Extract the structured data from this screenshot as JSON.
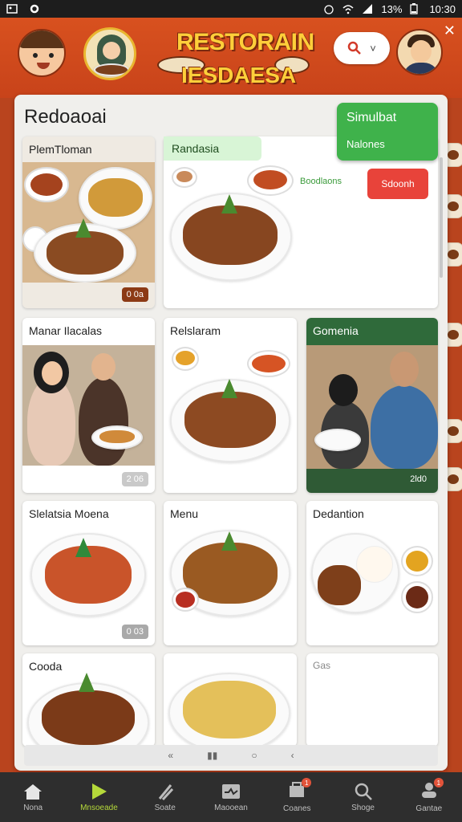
{
  "status_bar": {
    "battery": "13%",
    "time": "10:30"
  },
  "header": {
    "logo_line1": "RESTORAIN",
    "logo_line2": "IESDAESA",
    "search_chevron": "˅",
    "close": "✕"
  },
  "panel": {
    "title": "Redoaoai"
  },
  "popup": {
    "line1": "Simulbat",
    "line2": "Nalones"
  },
  "cards": {
    "c1": {
      "title": "PlemTloman",
      "badge": "0 0a"
    },
    "c2": {
      "tag": "Randasia",
      "link": "Boodlaons",
      "button": "Sdoonh"
    },
    "c3": {
      "title": "Manar Ilacalas",
      "badge": "2 06"
    },
    "c4": {
      "title": "Relslaram"
    },
    "c5": {
      "title": "Gomenia",
      "badge": "2ld0"
    },
    "c6": {
      "title": "Slelatsia Moena",
      "badge": "0 03"
    },
    "c7": {
      "title": "Menu"
    },
    "c8": {
      "title": "Dedantion"
    },
    "c9": {
      "title": "Cooda"
    },
    "c11": {
      "title": "Gas"
    }
  },
  "panel_nav": [
    "«",
    "▮▮",
    "○",
    "‹"
  ],
  "bottom_nav": [
    {
      "label": "Nona",
      "icon": "home-icon",
      "active": false
    },
    {
      "label": "Mnsoeade",
      "icon": "play-icon",
      "active": true
    },
    {
      "label": "Soate",
      "icon": "utensils-icon",
      "active": false
    },
    {
      "label": "Maooean",
      "icon": "message-icon",
      "active": false
    },
    {
      "label": "Coanes",
      "icon": "cart-icon",
      "active": false,
      "badge": "1"
    },
    {
      "label": "Shoge",
      "icon": "search-icon",
      "active": false
    },
    {
      "label": "Gantae",
      "icon": "profile-icon",
      "active": false,
      "badge": "1"
    }
  ],
  "colors": {
    "header": "#d04a1d",
    "accent_green": "#3fb24b",
    "active_nav": "#b5d93a",
    "red_button": "#e8433a"
  }
}
